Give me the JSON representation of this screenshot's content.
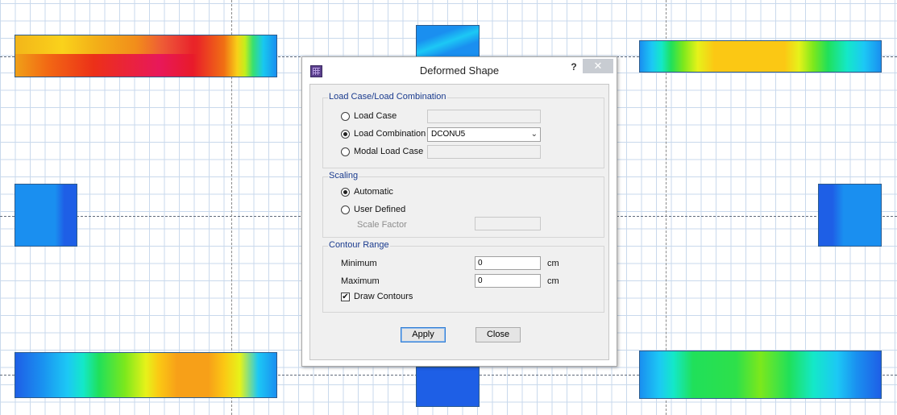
{
  "dialog": {
    "title": "Deformed Shape",
    "help_label": "?",
    "close_label": "✕",
    "icon": "app-grid-icon",
    "load_group": {
      "title": "Load Case/Load Combination",
      "options": [
        {
          "label": "Load Case",
          "selected": false,
          "value": ""
        },
        {
          "label": "Load Combination",
          "selected": true,
          "value": "DCONU5"
        },
        {
          "label": "Modal Load Case",
          "selected": false,
          "value": ""
        }
      ]
    },
    "scaling_group": {
      "title": "Scaling",
      "options": [
        {
          "label": "Automatic",
          "selected": true
        },
        {
          "label": "User Defined",
          "selected": false
        }
      ],
      "scale_factor_label": "Scale Factor",
      "scale_factor_value": ""
    },
    "contour_group": {
      "title": "Contour Range",
      "minimum_label": "Minimum",
      "minimum_value": "0",
      "maximum_label": "Maximum",
      "maximum_value": "0",
      "unit": "cm",
      "draw_contours_label": "Draw Contours",
      "draw_contours_checked": true
    },
    "buttons": {
      "apply": "Apply",
      "close": "Close"
    }
  },
  "colors": {
    "grid": "#c9d9ec",
    "contour_palette": [
      "#1e5fe6",
      "#1a8ff0",
      "#1cc8f5",
      "#14e8c8",
      "#20e05a",
      "#7ce81c",
      "#e6f21a",
      "#fbc814",
      "#f79a18",
      "#f55a14",
      "#e81414",
      "#e0145c"
    ]
  }
}
